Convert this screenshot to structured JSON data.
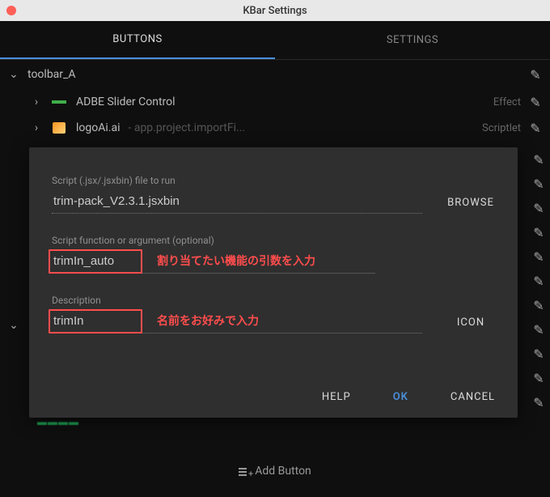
{
  "window": {
    "title": "KBar Settings"
  },
  "tabs": {
    "buttons": "BUTTONS",
    "settings": "SETTINGS"
  },
  "toolbar": {
    "name": "toolbar_A",
    "items": [
      {
        "label": "ADBE Slider Control",
        "sub": "",
        "type": "Effect"
      },
      {
        "label": "logoAi.ai",
        "sub": " - app.project.importFi...",
        "type": "Scriptlet"
      }
    ]
  },
  "dialog": {
    "script_label": "Script (.jsx/.jsxbin) file to run",
    "script_value": "trim-pack_V2.3.1.jsxbin",
    "browse": "BROWSE",
    "arg_label": "Script function or argument (optional)",
    "arg_value": "trimIn_auto",
    "arg_note": "割り当てたい機能の引数を入力",
    "desc_label": "Description",
    "desc_value": "trimIn",
    "desc_note": "名前をお好みで入力",
    "icon_btn": "ICON",
    "help": "HELP",
    "ok": "OK",
    "cancel": "CANCEL"
  },
  "add_button_label": "Add Button"
}
